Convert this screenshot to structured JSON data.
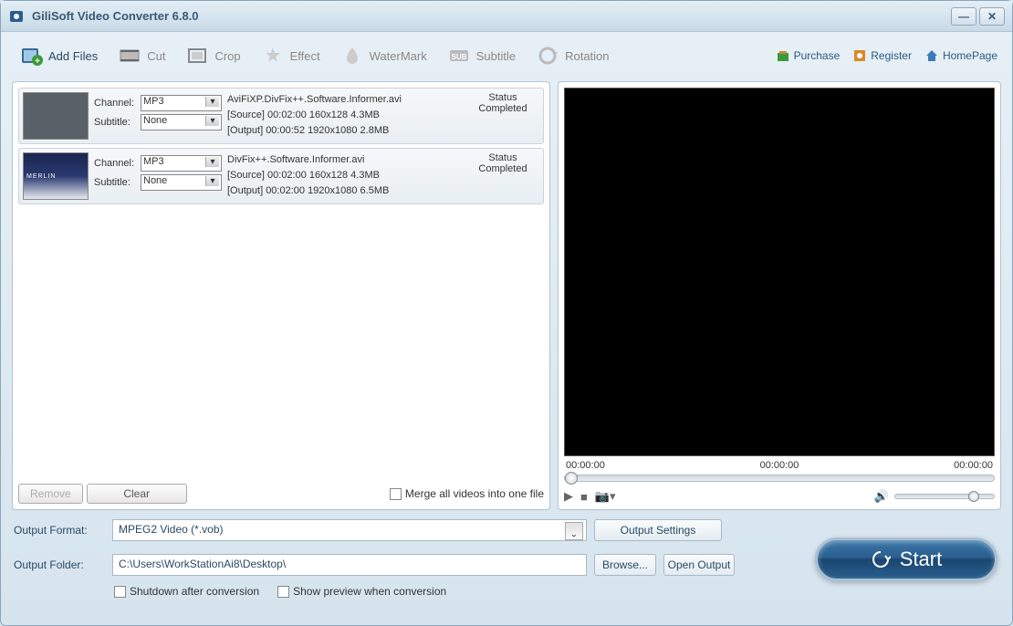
{
  "title": "GiliSoft Video Converter 6.8.0",
  "toolbar": {
    "addfiles": "Add Files",
    "cut": "Cut",
    "crop": "Crop",
    "effect": "Effect",
    "watermark": "WaterMark",
    "subtitle": "Subtitle",
    "rotation": "Rotation",
    "purchase": "Purchase",
    "register": "Register",
    "homepage": "HomePage"
  },
  "list": {
    "channel_label": "Channel:",
    "subtitle_label": "Subtitle:",
    "status_header": "Status",
    "items": [
      {
        "channel": "MP3",
        "subtitle": "None",
        "name": "AviFiXP.DivFix++.Software.Informer.avi",
        "source": "[Source]  00:02:00  160x128  4.3MB",
        "output": "[Output]  00:00:52  1920x1080  2.8MB",
        "status": "Completed"
      },
      {
        "channel": "MP3",
        "subtitle": "None",
        "name": "DivFix++.Software.Informer.avi",
        "source": "[Source]  00:02:00  160x128  4.3MB",
        "output": "[Output]  00:02:00  1920x1080  6.5MB",
        "status": "Completed"
      }
    ],
    "remove": "Remove",
    "clear": "Clear",
    "merge": "Merge all videos into one file"
  },
  "preview": {
    "t1": "00:00:00",
    "t2": "00:00:00",
    "t3": "00:00:00"
  },
  "output": {
    "format_label": "Output Format:",
    "format_value": "MPEG2 Video (*.vob)",
    "folder_label": "Output Folder:",
    "folder_value": "C:\\Users\\WorkStationAi8\\Desktop\\",
    "settings": "Output Settings",
    "browse": "Browse...",
    "open": "Open Output",
    "shutdown": "Shutdown after conversion",
    "showpreview": "Show preview when conversion",
    "start": "Start"
  }
}
